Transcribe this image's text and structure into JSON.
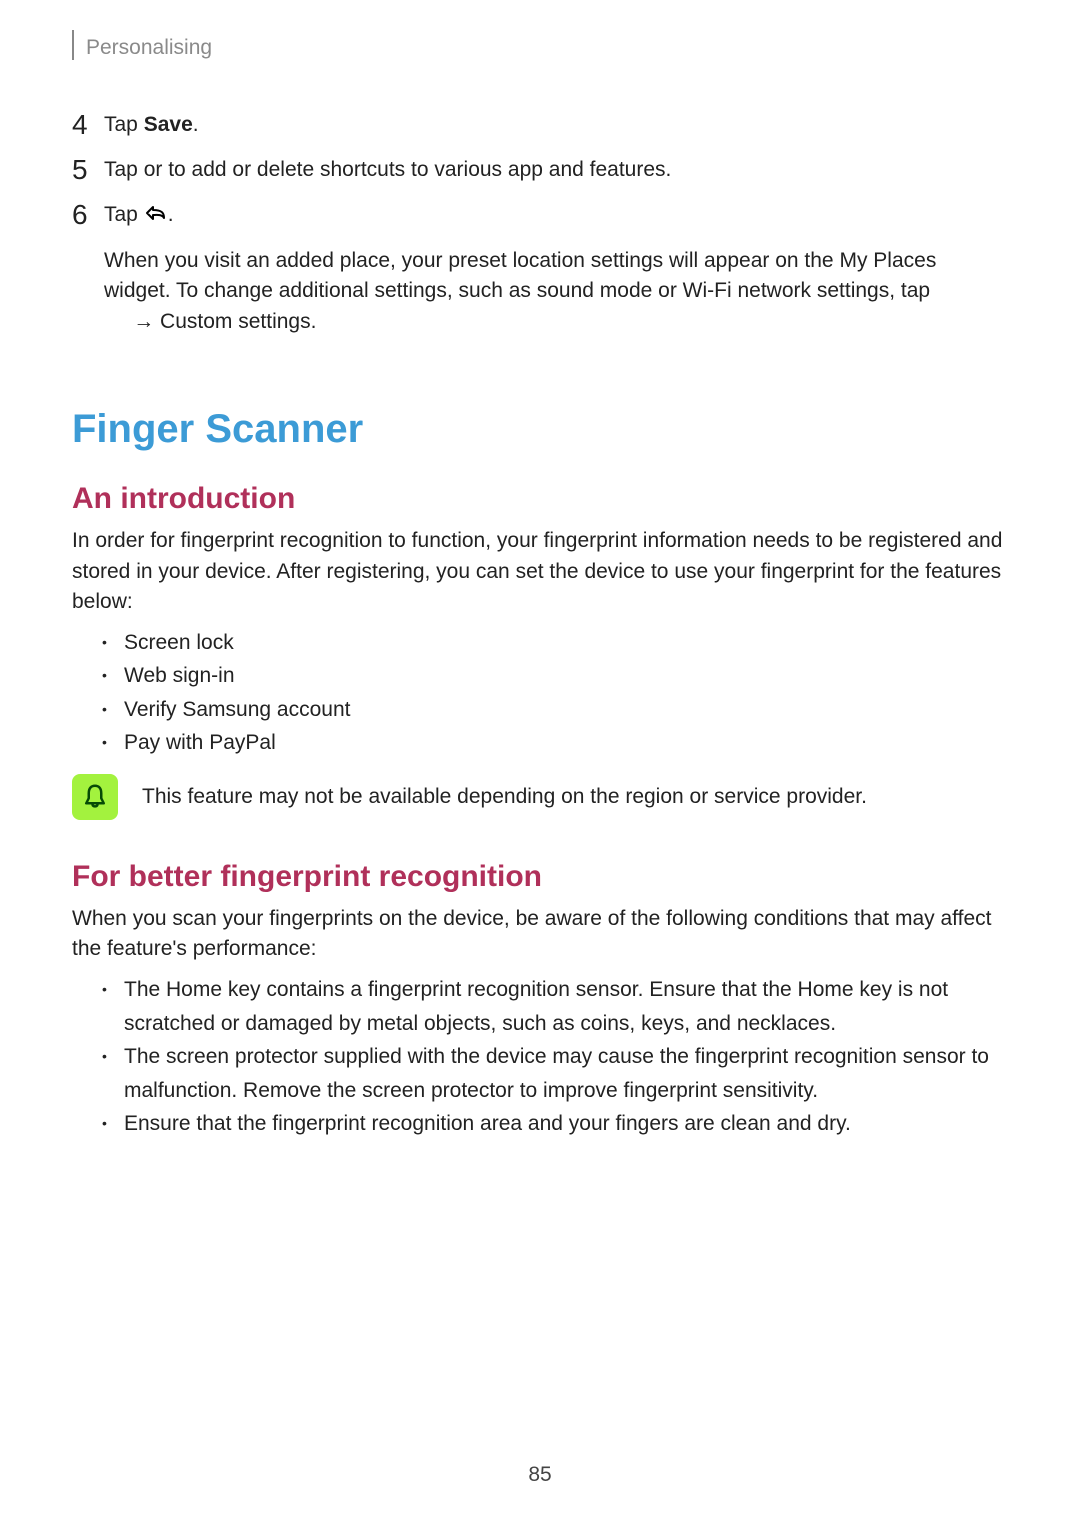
{
  "header": {
    "breadcrumb": "Personalising"
  },
  "steps": {
    "s4": {
      "num": "4",
      "tap": "Tap",
      "save": "Save",
      "period": "."
    },
    "s5": {
      "num": "5",
      "text": "Tap     or     to add or delete shortcuts to various app and features."
    },
    "s6": {
      "num": "6",
      "tap": "Tap",
      "period": "."
    }
  },
  "after6": {
    "line1a": "When you visit an added place, your preset location settings will appear on",
    "line1b_bold": "My Places",
    "line1c": " the",
    "line2a": "widget. To change additional settings, such as sound mode or",
    "line2b": "Wi-Fi network settings, tap",
    "arrow": "→",
    "custom_bold": "Custom settings",
    "line3_end": "."
  },
  "finger": {
    "title": "Finger Scanner",
    "intro_h": "An introduction",
    "intro_p": "In order for fingerprint recognition to function, your fingerprint information needs to be registered and stored in your device. After registering, you can set the device to use your fingerprint for the features below:",
    "intro_list": [
      "Screen lock",
      "Web sign-in",
      "Verify Samsung account",
      "Pay with PayPal"
    ],
    "note": "This feature may not be available depending on the region or service provider.",
    "better_h": "For better fingerprint recognition",
    "better_p": "When you scan your fingerprints on the device, be aware of the following conditions that may affect the feature's performance:",
    "better_list": [
      "The Home key contains a fingerprint recognition sensor. Ensure that the Home key is not scratched or damaged by metal objects, such as coins, keys, and necklaces.",
      "The screen protector supplied with the device may cause the fingerprint recognition sensor to malfunction. Remove the screen protector to improve fingerprint sensitivity.",
      "Ensure that the fingerprint recognition area and your fingers are clean and dry."
    ]
  },
  "page_number": "85"
}
